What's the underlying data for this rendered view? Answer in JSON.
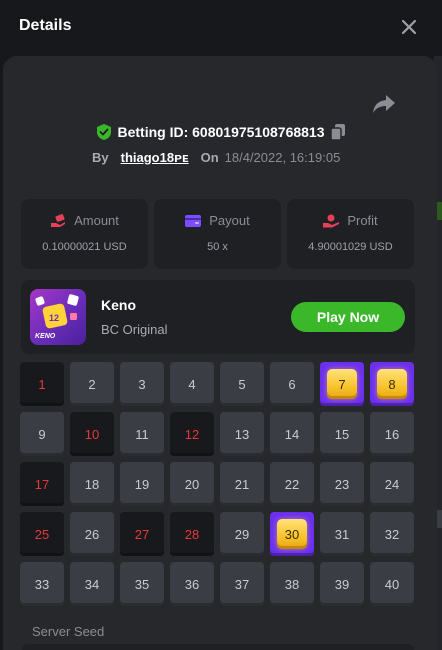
{
  "header": {
    "title": "Details"
  },
  "bet": {
    "label": "Betting ID: 6080197510876881",
    "suffix": "3",
    "by_label": "By",
    "user": "thiago18ᴘᴇ",
    "on_label": "On",
    "date": "18/4/2022, 16:19:05"
  },
  "stats": [
    {
      "label": "Amount",
      "value": "0.10000021 USD",
      "icon": "money-hand-icon",
      "color": "#e8405a"
    },
    {
      "label": "Payout",
      "value": "50 x",
      "icon": "wallet-icon",
      "color": "#7c4dff"
    },
    {
      "label": "Profit",
      "value": "4.90001029 USD",
      "icon": "profit-hand-icon",
      "color": "#e8405a"
    }
  ],
  "game": {
    "name": "Keno",
    "subtitle": "BC Original",
    "play_label": "Play Now",
    "thumb_text": "KENO"
  },
  "grid": {
    "numbers": [
      "1",
      "2",
      "3",
      "4",
      "5",
      "6",
      "7",
      "8",
      "9",
      "10",
      "11",
      "12",
      "13",
      "14",
      "15",
      "16",
      "17",
      "18",
      "19",
      "20",
      "21",
      "22",
      "23",
      "24",
      "25",
      "26",
      "27",
      "28",
      "29",
      "30",
      "31",
      "32",
      "33",
      "34",
      "35",
      "36",
      "37",
      "38",
      "39",
      "40"
    ],
    "hits": [
      "7",
      "8",
      "30"
    ],
    "misses": [
      "1",
      "10",
      "12",
      "17",
      "25",
      "27",
      "28"
    ]
  },
  "seed": {
    "label": "Server Seed"
  },
  "colors": {
    "accent_green": "#3bb82a",
    "hit_purple": "#6b2ff0",
    "gem_gold": "#f8c32a",
    "miss_red": "#e5383b"
  }
}
